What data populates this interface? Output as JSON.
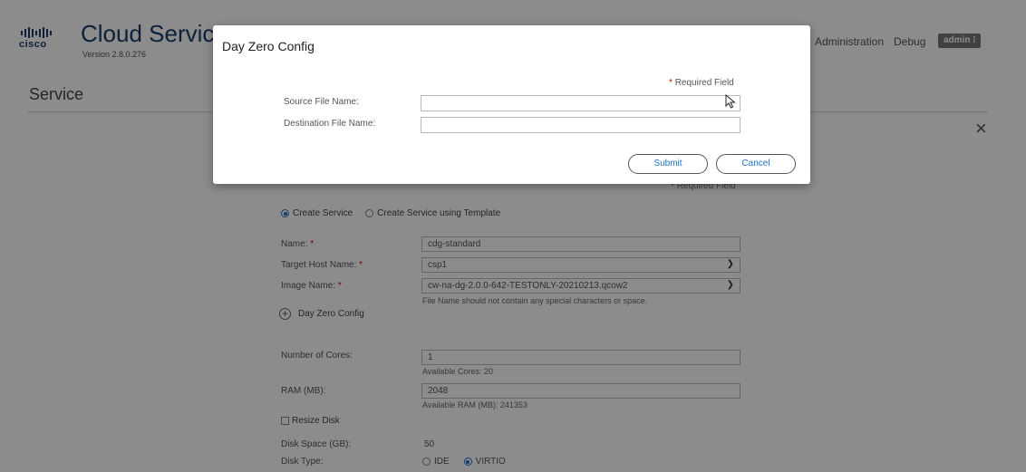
{
  "header": {
    "logo_text": "cisco",
    "product_title": "Cloud Service",
    "version": "Version  2.8.0.276",
    "nav": {
      "administration": "Administration",
      "debug": "Debug"
    },
    "user_badge": "admin ⁝"
  },
  "page": {
    "title": "Service",
    "close_icon": "×"
  },
  "form": {
    "required_note": "Required Field",
    "create_mode": {
      "option_create": "Create Service",
      "option_template": "Create Service using Template",
      "selected": "Create Service"
    },
    "name": {
      "label": "Name:",
      "value": "cdg-standard"
    },
    "target_host": {
      "label": "Target Host Name:",
      "value": "csp1"
    },
    "image": {
      "label": "Image Name:",
      "value": "cw-na-dg-2.0.0-642-TESTONLY-20210213.qcow2",
      "hint": "File Name should not contain any special characters or space."
    },
    "day_zero": {
      "label": "Day Zero Config"
    },
    "cores": {
      "label": "Number of Cores:",
      "value": "1",
      "hint": "Available Cores: 20"
    },
    "ram": {
      "label": "RAM (MB):",
      "value": "2048",
      "hint": "Available RAM (MB): 241353"
    },
    "resize_disk": {
      "label": "Resize Disk",
      "checked": false
    },
    "disk_space": {
      "label": "Disk Space (GB):",
      "value": "50"
    },
    "disk_type": {
      "label": "Disk Type:",
      "option_ide": "IDE",
      "option_virtio": "VIRTIO",
      "selected": "VIRTIO"
    }
  },
  "modal": {
    "title": "Day Zero Config",
    "required_note": "Required Field",
    "source_label": "Source File Name:",
    "source_value": "",
    "destination_label": "Destination File Name:",
    "destination_value": "",
    "submit_label": "Submit",
    "cancel_label": "Cancel"
  },
  "colors": {
    "brand_navy": "#1b3d6b",
    "accent_blue": "#1a73c7",
    "required_red": "#d00000",
    "overlay": "rgba(0,0,0,0.45)"
  },
  "icons": [
    "cisco-logo",
    "close-icon",
    "chevron-down-icon",
    "plus-circle-icon",
    "mouse-pointer-icon"
  ]
}
